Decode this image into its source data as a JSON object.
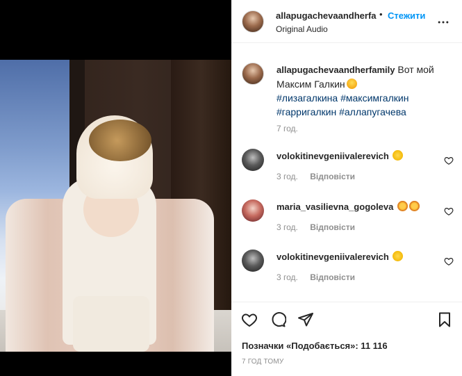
{
  "header": {
    "username": "allapugachevaandherfa",
    "separator": "•",
    "follow_label": "Стежити",
    "audio": "Original Audio",
    "more_icon": "more-horizontal-icon"
  },
  "caption": {
    "username": "allapugachevaandherfamily",
    "text": "Вот мой Максим Галкин",
    "emoji": "astonished-emoji",
    "hashtags_line1": "#лизагалкина #максимгалкин",
    "hashtags_line2": "#гарригалкин #аллапугачева",
    "time": "7 год."
  },
  "comments": [
    {
      "username": "volokitinevgeniivalerevich",
      "emoji": "clapping-emoji",
      "time": "3 год.",
      "reply": "Відповісти"
    },
    {
      "username": "maria_vasilievna_gogoleva",
      "emoji": "star-struck-emoji star-struck-emoji",
      "time": "3 год.",
      "reply": "Відповісти"
    },
    {
      "username": "volokitinevgeniivalerevich",
      "emoji": "clapping-emoji",
      "time": "3 год.",
      "reply": "Відповісти"
    }
  ],
  "actions": {
    "like_icon": "heart-icon",
    "comment_icon": "comment-icon",
    "share_icon": "share-icon",
    "save_icon": "bookmark-icon",
    "likes_text": "Позначки «Подобається»: 11 116",
    "date": "7 ГОД ТОМУ"
  },
  "colors": {
    "link": "#0095f6",
    "hashtag": "#00376b",
    "muted": "#8e8e8e",
    "text": "#262626"
  }
}
